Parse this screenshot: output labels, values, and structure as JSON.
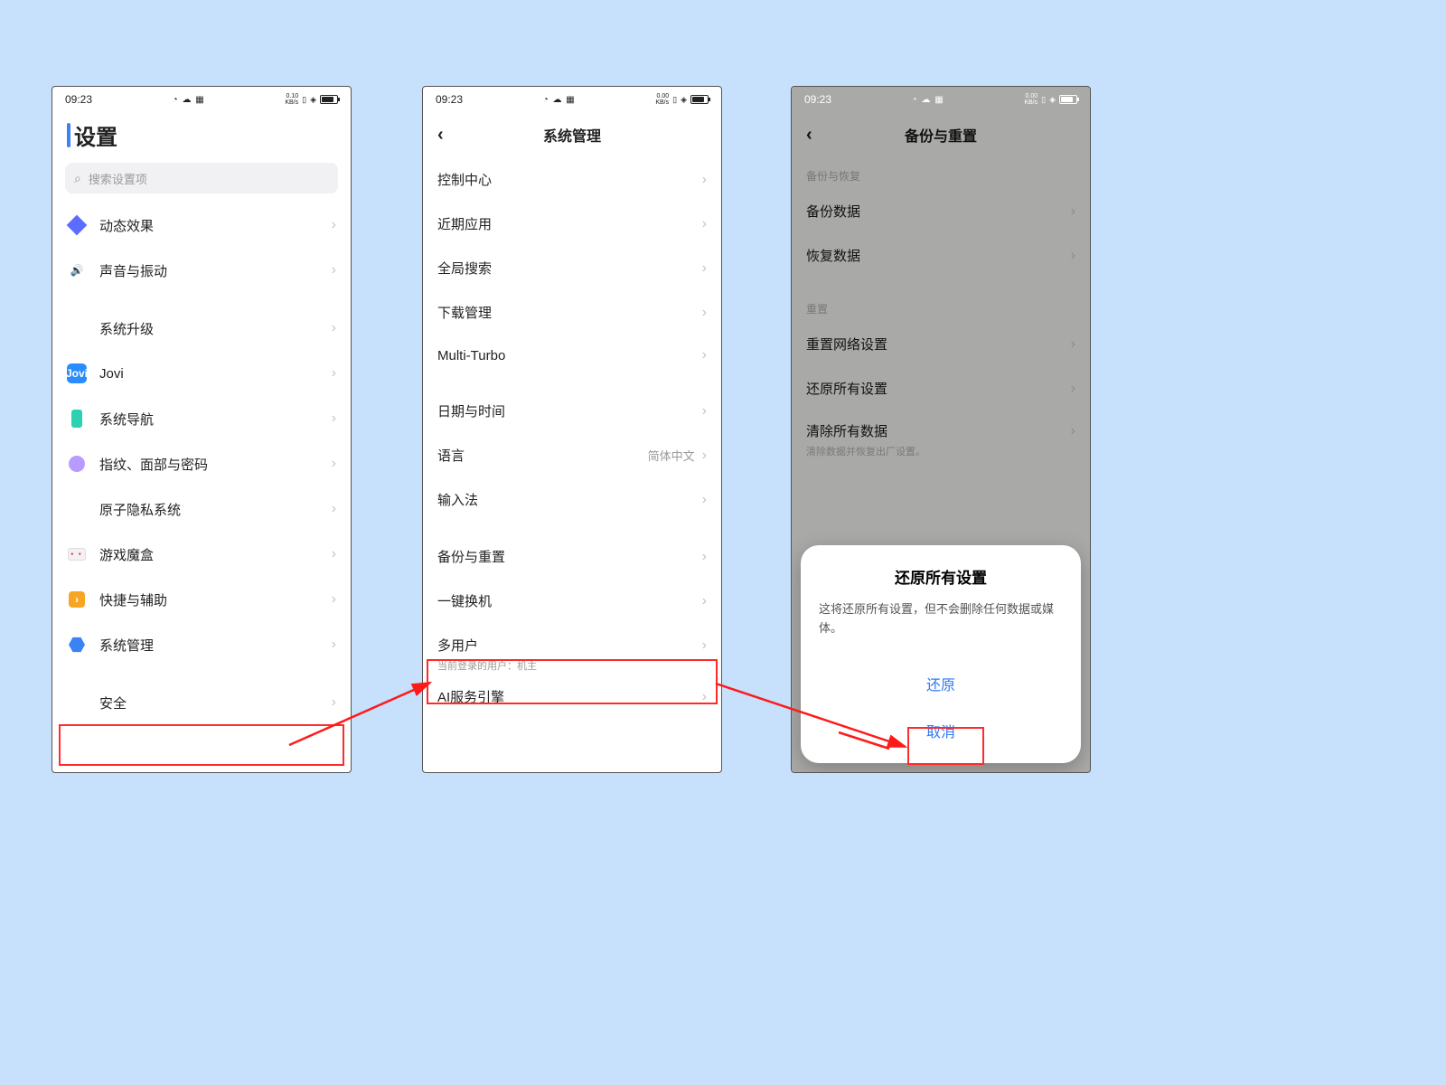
{
  "status": {
    "time": "09:23",
    "net1": "0.10",
    "net1u": "KB/s",
    "net2": "0.00",
    "net2u": "KB/s"
  },
  "s1": {
    "title": "设置",
    "search_placeholder": "搜索设置项",
    "rows": {
      "dynamic": "动态效果",
      "sound": "声音与振动",
      "upgrade": "系统升级",
      "jovi": "Jovi",
      "nav": "系统导航",
      "biometrics": "指纹、面部与密码",
      "privacy": "原子隐私系统",
      "gamebox": "游戏魔盒",
      "shortcut": "快捷与辅助",
      "sysmgmt": "系统管理",
      "security": "安全"
    }
  },
  "s2": {
    "title": "系统管理",
    "rows": {
      "control": "控制中心",
      "recent": "近期应用",
      "gsearch": "全局搜索",
      "download": "下载管理",
      "multiturbo": "Multi-Turbo",
      "datetime": "日期与时间",
      "language": "语言",
      "language_val": "简体中文",
      "ime": "输入法",
      "backup": "备份与重置",
      "oneclick": "一键换机",
      "multiuser": "多用户",
      "multiuser_sub": "当前登录的用户：机主",
      "aiengine": "AI服务引擎"
    }
  },
  "s3": {
    "title": "备份与重置",
    "sec1": "备份与恢复",
    "backup_data": "备份数据",
    "restore_data": "恢复数据",
    "sec2": "重置",
    "reset_net": "重置网络设置",
    "reset_all": "还原所有设置",
    "erase": "清除所有数据",
    "erase_sub": "清除数据并恢复出厂设置。",
    "dialog": {
      "title": "还原所有设置",
      "desc": "这将还原所有设置，但不会删除任何数据或媒体。",
      "confirm": "还原",
      "cancel": "取消"
    }
  }
}
